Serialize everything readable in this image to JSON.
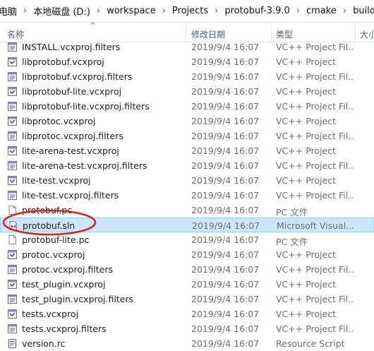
{
  "breadcrumb": [
    "电脑",
    "本地磁盘 (D:)",
    "workspace",
    "Projects",
    "protobuf-3.9.0",
    "cmake",
    "build"
  ],
  "columns": {
    "name": "名称",
    "date": "修改日期",
    "type": "类型",
    "size": "大小"
  },
  "files": [
    {
      "name": "INSTALL.vcxproj.filters",
      "date": "2019/9/4 16:07",
      "type": "VC++ Project Fil...",
      "icon": "vcxproj-filters-icon"
    },
    {
      "name": "libprotobuf.vcxproj",
      "date": "2019/9/4 16:07",
      "type": "VC++ Project",
      "icon": "vcxproj-icon"
    },
    {
      "name": "libprotobuf.vcxproj.filters",
      "date": "2019/9/4 16:07",
      "type": "VC++ Project Fil...",
      "icon": "vcxproj-filters-icon"
    },
    {
      "name": "libprotobuf-lite.vcxproj",
      "date": "2019/9/4 16:07",
      "type": "VC++ Project",
      "icon": "vcxproj-icon"
    },
    {
      "name": "libprotobuf-lite.vcxproj.filters",
      "date": "2019/9/4 16:07",
      "type": "VC++ Project Fil...",
      "icon": "vcxproj-filters-icon"
    },
    {
      "name": "libprotoc.vcxproj",
      "date": "2019/9/4 16:07",
      "type": "VC++ Project",
      "icon": "vcxproj-icon"
    },
    {
      "name": "libprotoc.vcxproj.filters",
      "date": "2019/9/4 16:07",
      "type": "VC++ Project Fil...",
      "icon": "vcxproj-filters-icon"
    },
    {
      "name": "lite-arena-test.vcxproj",
      "date": "2019/9/4 16:07",
      "type": "VC++ Project",
      "icon": "vcxproj-icon"
    },
    {
      "name": "lite-arena-test.vcxproj.filters",
      "date": "2019/9/4 16:07",
      "type": "VC++ Project Fil...",
      "icon": "vcxproj-filters-icon"
    },
    {
      "name": "lite-test.vcxproj",
      "date": "2019/9/4 16:07",
      "type": "VC++ Project",
      "icon": "vcxproj-icon"
    },
    {
      "name": "lite-test.vcxproj.filters",
      "date": "2019/9/4 16:07",
      "type": "VC++ Project Fil...",
      "icon": "vcxproj-filters-icon"
    },
    {
      "name": "protobuf.pc",
      "date": "2019/9/4 16:07",
      "type": "PC 文件",
      "icon": "blank-file-icon"
    },
    {
      "name": "protobuf.sln",
      "date": "2019/9/4 16:07",
      "type": "Microsoft Visual...",
      "icon": "visual-studio-solution-icon",
      "selected": true
    },
    {
      "name": "protobuf-lite.pc",
      "date": "2019/9/4 16:07",
      "type": "PC 文件",
      "icon": "blank-file-icon"
    },
    {
      "name": "protoc.vcxproj",
      "date": "2019/9/4 16:07",
      "type": "VC++ Project",
      "icon": "vcxproj-icon"
    },
    {
      "name": "protoc.vcxproj.filters",
      "date": "2019/9/4 16:07",
      "type": "VC++ Project Fil...",
      "icon": "vcxproj-filters-icon"
    },
    {
      "name": "test_plugin.vcxproj",
      "date": "2019/9/4 16:07",
      "type": "VC++ Project",
      "icon": "vcxproj-icon"
    },
    {
      "name": "test_plugin.vcxproj.filters",
      "date": "2019/9/4 16:07",
      "type": "VC++ Project Fil...",
      "icon": "vcxproj-filters-icon"
    },
    {
      "name": "tests.vcxproj",
      "date": "2019/9/4 16:07",
      "type": "VC++ Project",
      "icon": "vcxproj-icon"
    },
    {
      "name": "tests.vcxproj.filters",
      "date": "2019/9/4 16:07",
      "type": "VC++ Project Fil...",
      "icon": "vcxproj-filters-icon"
    },
    {
      "name": "version.rc",
      "date": "2019/9/4 16:07",
      "type": "Resource Script",
      "icon": "resource-script-icon"
    }
  ],
  "colors": {
    "selection_bg": "#cce8ff",
    "selection_border": "#99d1ff",
    "annotation": "#e0201b",
    "header_text": "#4c607a"
  }
}
